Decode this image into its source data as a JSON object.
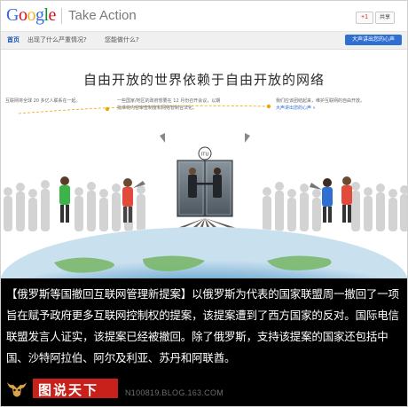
{
  "header": {
    "logo_letters": [
      {
        "ch": "G",
        "color": "#3369e8"
      },
      {
        "ch": "o",
        "color": "#d50f25"
      },
      {
        "ch": "o",
        "color": "#eeb211"
      },
      {
        "ch": "g",
        "color": "#3369e8"
      },
      {
        "ch": "l",
        "color": "#009925"
      },
      {
        "ch": "e",
        "color": "#d50f25"
      }
    ],
    "product": "Take Action",
    "gplus_label": "+1",
    "share_label": "共享"
  },
  "nav": {
    "items": [
      "首页",
      "出现了什么严重情况?",
      "您能做什么?"
    ],
    "cta": "大声讲出您的心声"
  },
  "hero": {
    "title": "自由开放的世界依赖于自由开放的网络",
    "columns": [
      {
        "text": "互联网将全球 20 多亿人联系在一起。"
      },
      {
        "text": "一些国家/地区的政府想要在 12 月份召开会议，以期批准将内容审查制度和网络管制合法化。"
      },
      {
        "text": "我们应该团结起来，维护互联网的自由开放。",
        "link": "大声讲出您的心声 »"
      }
    ],
    "badge_text": "ITU"
  },
  "caption": {
    "text": "【俄罗斯等国撤回互联网管理新提案】以俄罗斯为代表的国家联盟周一撤回了一项旨在赋予政府更多互联网控制权的提案，该提案遭到了西方国家的反对。国际电信联盟发言人证实，该提案已经被撤回。除了俄罗斯，支持该提案的国家还包括中国、沙特阿拉伯、阿尔及利亚、苏丹和阿联酋。"
  },
  "footer": {
    "brand_text": "图说天下",
    "url": "N100819.BLOG.163.COM"
  },
  "colors": {
    "accent": "#2f6fd1",
    "caption_bg": "#000000",
    "brand_red": "#c8201b"
  }
}
